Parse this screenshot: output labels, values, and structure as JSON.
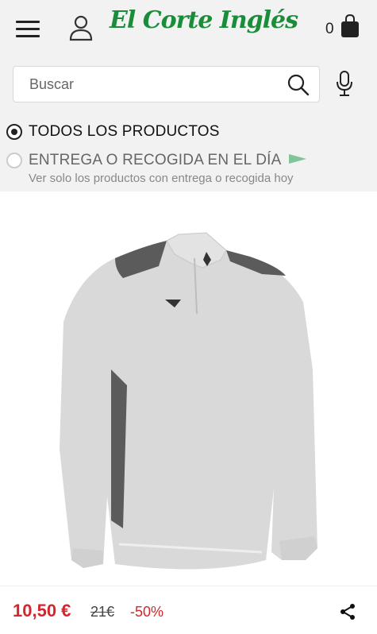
{
  "header": {
    "logo_text": "El Corte Inglés",
    "cart_count": "0",
    "brand_color": "#1a8d3a",
    "icons": [
      "menu-icon",
      "user-icon",
      "shopping-bag-icon"
    ]
  },
  "search": {
    "placeholder": "Buscar",
    "value": "",
    "icons": [
      "search-icon",
      "microphone-icon"
    ]
  },
  "filters": {
    "all_products": {
      "label": "TODOS LOS PRODUCTOS",
      "selected": true
    },
    "delivery": {
      "label": "ENTREGA O RECOGIDA EN EL DÍA",
      "sublabel": "Ver solo los productos con entrega o recogida hoy",
      "selected": false,
      "icon": "flag-icon",
      "icon_color": "#7fc59a"
    }
  },
  "product": {
    "price": "10,50 €",
    "old_price": "21€",
    "discount": "-50%",
    "price_color": "#d4262c",
    "icons": [
      "share-icon"
    ]
  }
}
